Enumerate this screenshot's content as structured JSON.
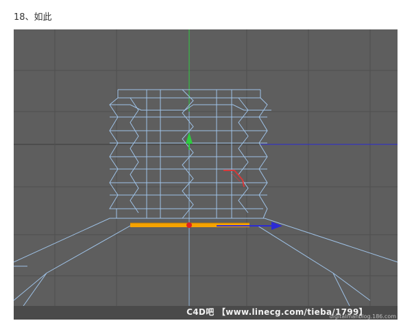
{
  "caption": "18、如此",
  "viewport": {
    "background": "#5e5e5e",
    "grid_color": "#4f4f4f",
    "wire_color": "#9fc3e8",
    "y_axis_color": "#2ecc40",
    "x_axis_color": "#2b2bd6",
    "selected_edge_color": "#f5a300",
    "pivot_color": "#e02020"
  },
  "watermark": "C4D吧 【www.linecg.com/tieba/1799】",
  "credit": "digitalmanblog.186.com"
}
